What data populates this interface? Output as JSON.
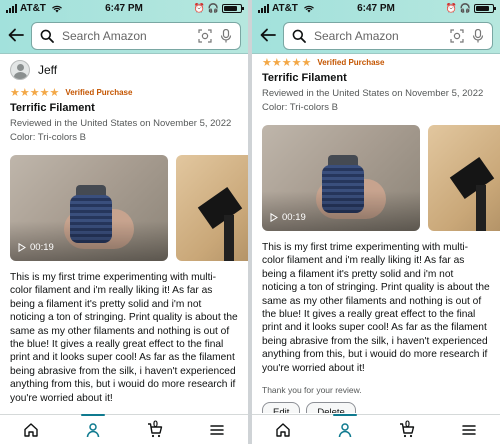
{
  "status_bar": {
    "carrier": "AT&T",
    "time": "6:47 PM"
  },
  "search": {
    "placeholder": "Search Amazon"
  },
  "review": {
    "reviewer_name": "Jeff",
    "stars": "★★★★★",
    "rating": 5,
    "verified_label": "Verified Purchase",
    "title": "Terrific Filament",
    "reviewed_in": "Reviewed in the United States on November 5, 2022",
    "color": "Color: Tri-colors B",
    "video_duration": "00:19",
    "body": "This is my first trime experimenting with multi-color filament and i'm really liking it! As far as being a filament it's pretty solid and i'm not noticing a ton of stringing. Print quality is about the same as my other filaments and nothing is out of the blue! It gives a really great effect to the final print and it looks super cool! As far as the filament being abrasive from the silk, i haven't experienced anything from this, but i wouid do more research if you're worried about it!",
    "thanks": "Thank you for your review."
  },
  "actions": {
    "edit_label": "Edit",
    "delete_label": "Delete"
  },
  "bottom_nav": {
    "cart_count": "0",
    "items": [
      "home-icon",
      "account-icon",
      "cart-icon",
      "menu-icon"
    ]
  },
  "colors": {
    "header_accent": "#a2e1dc",
    "star": "#f3a847",
    "verified": "#c45500",
    "nav_active": "#0f7a8f"
  }
}
